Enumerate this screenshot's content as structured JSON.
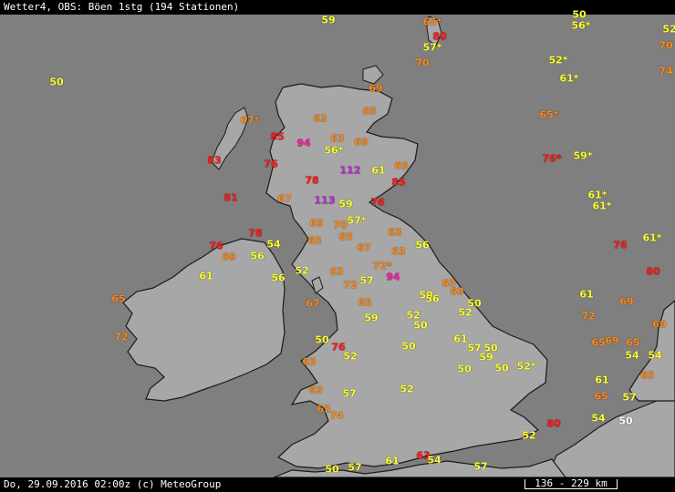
{
  "header": {
    "title": "Wetter4, OBS: Böen 1stg (194 Stationen)"
  },
  "footer": {
    "timestamp": "Do, 29.09.2016 02:00z (c) MeteoGroup",
    "scale_label": "136 - 229 km"
  },
  "colors": {
    "sea": "#7f7f7f",
    "land": "#a7a7a7",
    "coast": "#1a1a1a",
    "yellow": "#ffff33",
    "orange": "#ff8c1a",
    "red": "#ff1a1a",
    "magenta": "#ff1aa8",
    "purple": "#c02bd8",
    "white": "#ffffff"
  },
  "stations": [
    {
      "v": "59",
      "c": "yellow"
    },
    {
      "v": "65*",
      "c": "orange"
    },
    {
      "v": "80",
      "c": "red"
    },
    {
      "v": "57*",
      "c": "yellow"
    },
    {
      "v": "70",
      "c": "orange"
    },
    {
      "v": "56*",
      "c": "yellow"
    },
    {
      "v": "50",
      "c": "yellow"
    },
    {
      "v": "52",
      "c": "yellow"
    },
    {
      "v": "70",
      "c": "orange"
    },
    {
      "v": "52*",
      "c": "yellow"
    },
    {
      "v": "74",
      "c": "orange"
    },
    {
      "v": "61*",
      "c": "yellow"
    },
    {
      "v": "50",
      "c": "yellow"
    },
    {
      "v": "69",
      "c": "orange"
    },
    {
      "v": "67*",
      "c": "orange"
    },
    {
      "v": "63",
      "c": "orange"
    },
    {
      "v": "65",
      "c": "orange"
    },
    {
      "v": "65*",
      "c": "orange"
    },
    {
      "v": "85",
      "c": "red"
    },
    {
      "v": "94",
      "c": "magenta"
    },
    {
      "v": "63",
      "c": "orange"
    },
    {
      "v": "69",
      "c": "orange"
    },
    {
      "v": "56*",
      "c": "yellow"
    },
    {
      "v": "83",
      "c": "red"
    },
    {
      "v": "76",
      "c": "red"
    },
    {
      "v": "112",
      "c": "purple"
    },
    {
      "v": "61",
      "c": "yellow"
    },
    {
      "v": "65",
      "c": "orange"
    },
    {
      "v": "76*",
      "c": "red"
    },
    {
      "v": "59*",
      "c": "yellow"
    },
    {
      "v": "78",
      "c": "red"
    },
    {
      "v": "85",
      "c": "red"
    },
    {
      "v": "81",
      "c": "red"
    },
    {
      "v": "67",
      "c": "orange"
    },
    {
      "v": "113",
      "c": "purple"
    },
    {
      "v": "59",
      "c": "yellow"
    },
    {
      "v": "76",
      "c": "red"
    },
    {
      "v": "61*",
      "c": "yellow"
    },
    {
      "v": "61*",
      "c": "yellow"
    },
    {
      "v": "78",
      "c": "red"
    },
    {
      "v": "57*",
      "c": "yellow"
    },
    {
      "v": "65",
      "c": "orange"
    },
    {
      "v": "70",
      "c": "orange"
    },
    {
      "v": "63",
      "c": "orange"
    },
    {
      "v": "54",
      "c": "yellow"
    },
    {
      "v": "65",
      "c": "orange"
    },
    {
      "v": "65",
      "c": "orange"
    },
    {
      "v": "67",
      "c": "orange"
    },
    {
      "v": "63",
      "c": "orange"
    },
    {
      "v": "56",
      "c": "yellow"
    },
    {
      "v": "76",
      "c": "red"
    },
    {
      "v": "61*",
      "c": "yellow"
    },
    {
      "v": "76",
      "c": "red"
    },
    {
      "v": "69",
      "c": "orange"
    },
    {
      "v": "56",
      "c": "yellow"
    },
    {
      "v": "72*",
      "c": "orange"
    },
    {
      "v": "80",
      "c": "red"
    },
    {
      "v": "61",
      "c": "yellow"
    },
    {
      "v": "56",
      "c": "yellow"
    },
    {
      "v": "52",
      "c": "yellow"
    },
    {
      "v": "63",
      "c": "orange"
    },
    {
      "v": "57",
      "c": "yellow"
    },
    {
      "v": "94",
      "c": "magenta"
    },
    {
      "v": "65",
      "c": "orange"
    },
    {
      "v": "72",
      "c": "orange"
    },
    {
      "v": "69",
      "c": "orange"
    },
    {
      "v": "65",
      "c": "orange"
    },
    {
      "v": "50",
      "c": "yellow"
    },
    {
      "v": "56",
      "c": "yellow"
    },
    {
      "v": "50",
      "c": "yellow"
    },
    {
      "v": "61",
      "c": "yellow"
    },
    {
      "v": "67",
      "c": "orange"
    },
    {
      "v": "65",
      "c": "orange"
    },
    {
      "v": "69",
      "c": "orange"
    },
    {
      "v": "52",
      "c": "yellow"
    },
    {
      "v": "59",
      "c": "yellow"
    },
    {
      "v": "52",
      "c": "yellow"
    },
    {
      "v": "72",
      "c": "orange"
    },
    {
      "v": "50",
      "c": "yellow"
    },
    {
      "v": "69",
      "c": "orange"
    },
    {
      "v": "72",
      "c": "orange"
    },
    {
      "v": "50",
      "c": "yellow"
    },
    {
      "v": "76",
      "c": "red"
    },
    {
      "v": "52",
      "c": "yellow"
    },
    {
      "v": "50",
      "c": "yellow"
    },
    {
      "v": "61",
      "c": "yellow"
    },
    {
      "v": "57",
      "c": "yellow"
    },
    {
      "v": "50",
      "c": "yellow"
    },
    {
      "v": "65",
      "c": "orange"
    },
    {
      "v": "69",
      "c": "orange"
    },
    {
      "v": "65",
      "c": "orange"
    },
    {
      "v": "63",
      "c": "orange"
    },
    {
      "v": "59",
      "c": "yellow"
    },
    {
      "v": "50",
      "c": "yellow"
    },
    {
      "v": "50",
      "c": "yellow"
    },
    {
      "v": "52*",
      "c": "yellow"
    },
    {
      "v": "54",
      "c": "yellow"
    },
    {
      "v": "54",
      "c": "yellow"
    },
    {
      "v": "65",
      "c": "orange"
    },
    {
      "v": "61",
      "c": "yellow"
    },
    {
      "v": "63",
      "c": "orange"
    },
    {
      "v": "57",
      "c": "yellow"
    },
    {
      "v": "52",
      "c": "yellow"
    },
    {
      "v": "65",
      "c": "orange"
    },
    {
      "v": "57",
      "c": "yellow"
    },
    {
      "v": "63",
      "c": "orange"
    },
    {
      "v": "74",
      "c": "orange"
    },
    {
      "v": "80",
      "c": "red"
    },
    {
      "v": "54",
      "c": "yellow"
    },
    {
      "v": "50",
      "c": "white"
    },
    {
      "v": "52",
      "c": "yellow"
    },
    {
      "v": "61",
      "c": "yellow"
    },
    {
      "v": "63",
      "c": "red"
    },
    {
      "v": "54",
      "c": "yellow"
    },
    {
      "v": "57",
      "c": "yellow"
    },
    {
      "v": "50",
      "c": "yellow"
    },
    {
      "v": "57",
      "c": "yellow"
    }
  ]
}
